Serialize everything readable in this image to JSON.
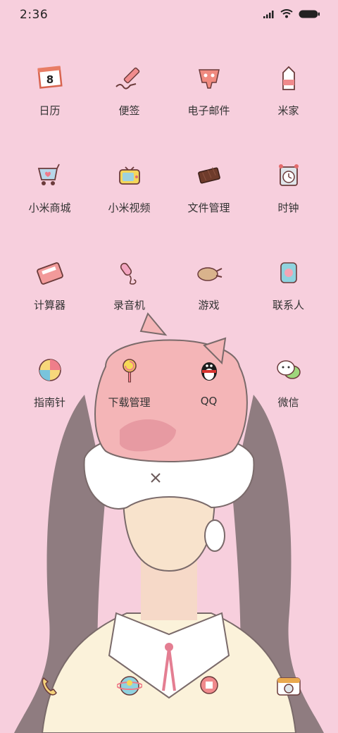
{
  "status_bar": {
    "time": "2:36",
    "icons": [
      "cellular-signal-icon",
      "wifi-icon",
      "battery-icon"
    ]
  },
  "home": {
    "apps": [
      {
        "name": "calendar",
        "label": "日历",
        "icon": "calendar-icon",
        "icon_text": "8"
      },
      {
        "name": "notes",
        "label": "便签",
        "icon": "pen-icon"
      },
      {
        "name": "email",
        "label": "电子邮件",
        "icon": "mail-pig-icon"
      },
      {
        "name": "mi-home",
        "label": "米家",
        "icon": "milk-carton-icon"
      },
      {
        "name": "mi-store",
        "label": "小米商城",
        "icon": "shopping-cart-icon"
      },
      {
        "name": "mi-video",
        "label": "小米视频",
        "icon": "tv-icon"
      },
      {
        "name": "file-manager",
        "label": "文件管理",
        "icon": "chocolate-icon"
      },
      {
        "name": "clock",
        "label": "时钟",
        "icon": "alarm-clock-icon"
      },
      {
        "name": "calculator",
        "label": "计算器",
        "icon": "calculator-icon"
      },
      {
        "name": "recorder",
        "label": "录音机",
        "icon": "microphone-icon"
      },
      {
        "name": "games",
        "label": "游戏",
        "icon": "roast-chicken-icon"
      },
      {
        "name": "contacts",
        "label": "联系人",
        "icon": "contacts-book-icon"
      },
      {
        "name": "compass",
        "label": "指南针",
        "icon": "compass-icon"
      },
      {
        "name": "downloads",
        "label": "下载管理",
        "icon": "lollipop-icon"
      },
      {
        "name": "qq",
        "label": "QQ",
        "icon": "penguin-icon"
      },
      {
        "name": "wechat",
        "label": "微信",
        "icon": "chat-bubbles-icon"
      }
    ]
  },
  "dock": {
    "apps": [
      {
        "name": "phone",
        "icon": "phone-icon"
      },
      {
        "name": "browser",
        "icon": "globe-icon"
      },
      {
        "name": "messages",
        "icon": "message-bubble-icon"
      },
      {
        "name": "camera",
        "icon": "camera-icon"
      }
    ]
  },
  "colors": {
    "background": "#f7cfdd",
    "label_text": "#333333",
    "status_text": "#222222"
  }
}
